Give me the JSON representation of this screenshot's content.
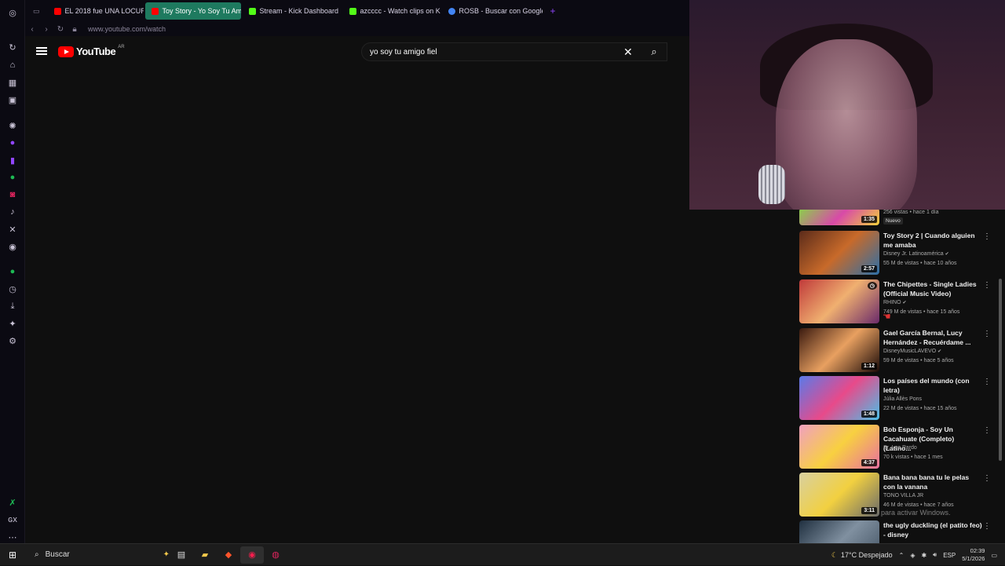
{
  "browser": {
    "tabs": [
      {
        "label": "EL 2018 fue UNA LOCURA",
        "color": "#e0245e"
      },
      {
        "label": "Toy Story - Yo Soy Tu Ami",
        "color": "#ff0000",
        "active": true
      },
      {
        "label": "Stream - Kick Dashboard",
        "color": "#53fc18"
      },
      {
        "label": "azcccc - Watch clips on K",
        "color": "#53fc18"
      },
      {
        "label": "ROSB - Buscar con Google",
        "color": "#4285f4"
      }
    ],
    "new_tab": "+",
    "url": "www.youtube.com/watch"
  },
  "youtube": {
    "logo_text": "YouTube",
    "region": "AR",
    "search_value": "yo soy tu amigo fiel"
  },
  "recommendations": [
    {
      "title": "",
      "channel": "",
      "meta": "256 vistas • hace 1 día",
      "badge": "Nuevo",
      "duration": "1:35",
      "thumb": "linear-gradient(135deg,#8ad14a,#d84aa8,#f2d03b)"
    },
    {
      "title": "Toy Story 2 | Cuando alguien me amaba",
      "channel": "Disney Jr. Latinoamérica",
      "verified": true,
      "meta": "55 M de vistas • hace 10 años",
      "duration": "2:57",
      "thumb": "linear-gradient(135deg,#5b2b1a,#c86a2a,#2c6fa8)"
    },
    {
      "title": "The Chipettes - Single Ladies (Official Music Video)",
      "channel": "RHINO",
      "verified": true,
      "meta": "749 M de vistas • hace 15 años",
      "duration": "",
      "thumb": "linear-gradient(135deg,#c03a3a,#f0b070,#6a2a6a)"
    },
    {
      "title": "Gael García Bernal, Lucy Hernández - Recuérdame ...",
      "channel": "DisneyMusicLAVEVO",
      "verified": true,
      "meta": "59 M de vistas • hace 5 años",
      "duration": "1:12",
      "thumb": "linear-gradient(135deg,#3a1a10,#e8a060,#1a0a08)"
    },
    {
      "title": "Los países del mundo (con letra)",
      "channel": "Júlia Allès Pons",
      "verified": false,
      "meta": "22 M de vistas • hace 15 años",
      "duration": "1:48",
      "thumb": "linear-gradient(135deg,#5a7ae8,#e84a8a,#4ac0e8)"
    },
    {
      "title": "Bob Esponja - Soy Un Cacahuate (Completo) (Latino...",
      "channel": "Sr. Leo Pardo",
      "verified": false,
      "meta": "70 k vistas • hace 1 mes",
      "duration": "4:37",
      "thumb": "linear-gradient(135deg,#f0a0c0,#f8d040,#e870a0)"
    },
    {
      "title": "Bana bana bana tu le pelas con la vanana",
      "channel": "TONO VILLA JR",
      "verified": false,
      "meta": "46 M de vistas • hace 7 años",
      "duration": "3:11",
      "thumb": "linear-gradient(135deg,#d8d0a0,#f2d040,#6a6a6a)"
    },
    {
      "title": "the ugly duckling (el patito feo) - disney",
      "channel": "",
      "verified": false,
      "meta": "",
      "duration": "",
      "thumb": "linear-gradient(135deg,#203040,#8090a0,#405060)"
    }
  ],
  "overlay": {
    "watermark": "para activar Windows."
  },
  "taskbar": {
    "search_label": "Buscar",
    "weather": "17°C  Despejado",
    "language": "ESP",
    "time": "02:39",
    "date": "5/1/2026"
  }
}
